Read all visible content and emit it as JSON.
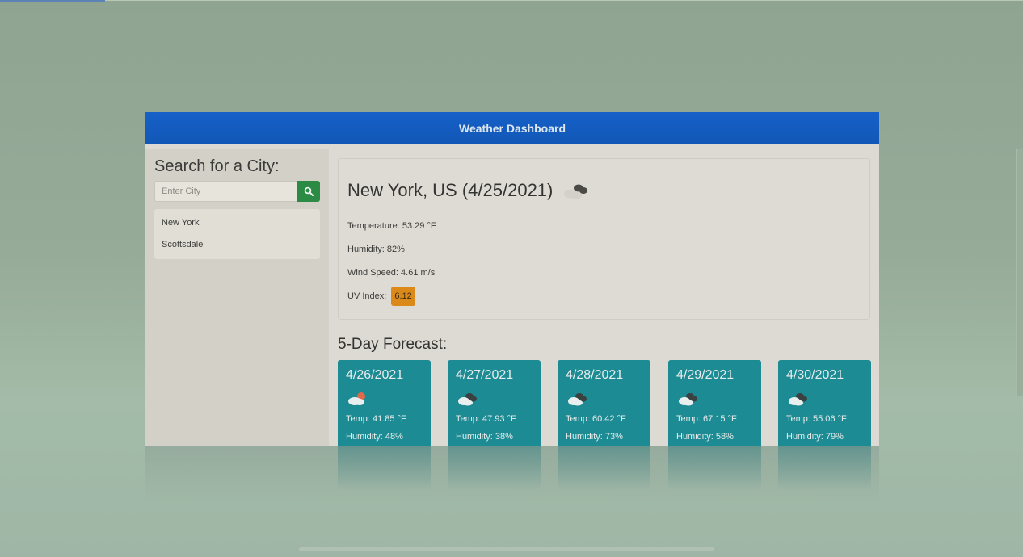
{
  "navbar": {
    "title": "Weather Dashboard"
  },
  "sidebar": {
    "heading": "Search for a City:",
    "search": {
      "placeholder": "Enter City",
      "value": ""
    },
    "search_button_icon": "search-icon",
    "history": [
      "New York",
      "Scottsdale"
    ]
  },
  "current": {
    "title": "New York, US (4/25/2021)",
    "icon": "broken-clouds-icon",
    "temperature": "Temperature: 53.29 °F",
    "humidity": "Humidity: 82%",
    "wind": "Wind Speed: 4.61 m/s",
    "uv_label": "UV Index:",
    "uv_value": "6.12"
  },
  "forecast": {
    "heading": "5-Day Forecast:",
    "days": [
      {
        "date": "4/26/2021",
        "icon": "few-clouds-icon",
        "temp": "Temp: 41.85 °F",
        "humidity": "Humidity: 48%"
      },
      {
        "date": "4/27/2021",
        "icon": "broken-clouds-icon",
        "temp": "Temp: 47.93 °F",
        "humidity": "Humidity: 38%"
      },
      {
        "date": "4/28/2021",
        "icon": "broken-clouds-icon",
        "temp": "Temp: 60.42 °F",
        "humidity": "Humidity: 73%"
      },
      {
        "date": "4/29/2021",
        "icon": "broken-clouds-icon",
        "temp": "Temp: 67.15 °F",
        "humidity": "Humidity: 58%"
      },
      {
        "date": "4/30/2021",
        "icon": "broken-clouds-icon",
        "temp": "Temp: 55.06 °F",
        "humidity": "Humidity: 79%"
      }
    ]
  },
  "colors": {
    "navbar": "#1660c8",
    "search_button": "#2b8a43",
    "uv_badge": "#db8a1a",
    "forecast_card": "#1d8b94"
  }
}
